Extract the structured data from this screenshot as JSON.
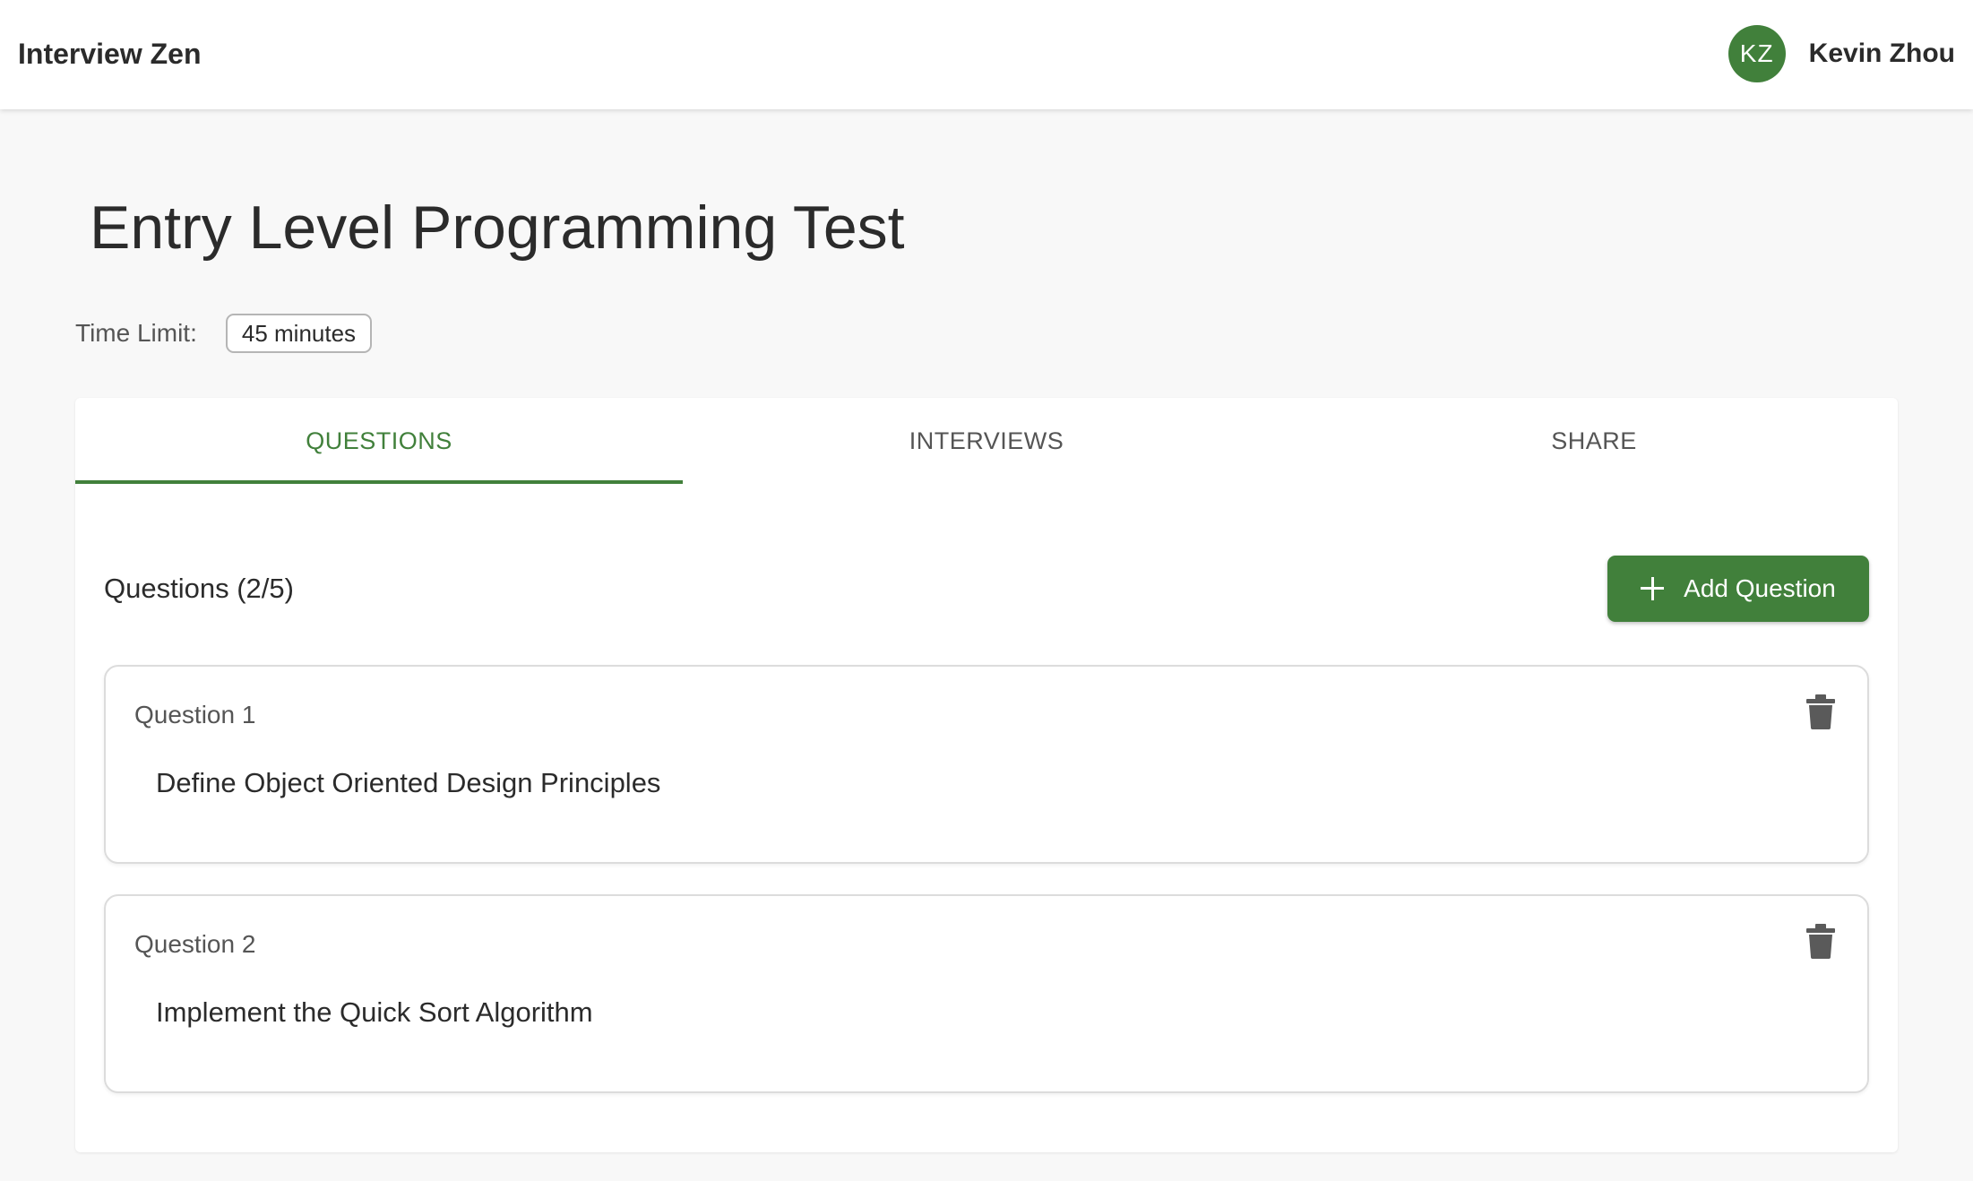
{
  "header": {
    "app_title": "Interview Zen",
    "user": {
      "initials": "KZ",
      "name": "Kevin Zhou"
    }
  },
  "test": {
    "title": "Entry Level Programming Test",
    "time_limit_label": "Time Limit:",
    "time_limit_value": "45 minutes"
  },
  "tabs": [
    {
      "label": "QUESTIONS",
      "active": true
    },
    {
      "label": "INTERVIEWS",
      "active": false
    },
    {
      "label": "SHARE",
      "active": false
    }
  ],
  "questions_section": {
    "title": "Questions (2/5)",
    "add_button_label": "Add Question",
    "items": [
      {
        "label": "Question 1",
        "text": "Define Object Oriented Design Principles"
      },
      {
        "label": "Question 2",
        "text": "Implement the Quick Sort Algorithm"
      }
    ]
  },
  "colors": {
    "accent": "#41803b",
    "background": "#f8f8f8",
    "text": "#2b2b2b",
    "muted_text": "#555555",
    "icon": "#5a5a5a"
  },
  "icons": {
    "add": "plus-icon",
    "delete": "trash-icon"
  }
}
